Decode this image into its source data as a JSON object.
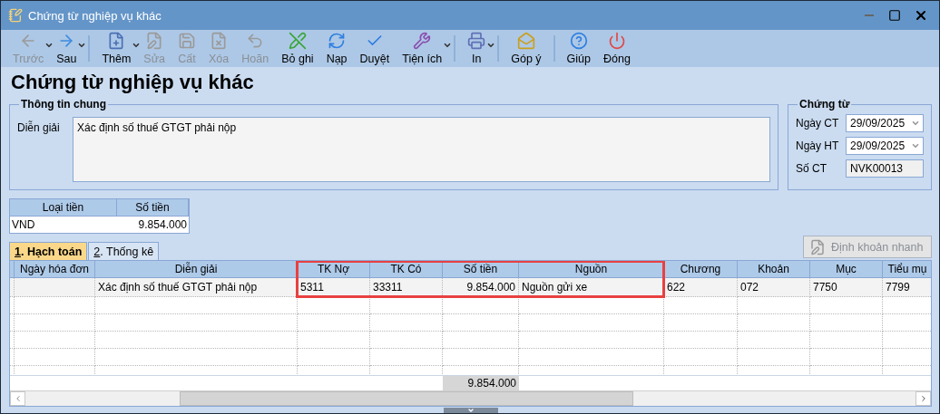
{
  "window": {
    "title": "Chứng từ nghiệp vụ khác"
  },
  "toolbar": [
    {
      "kind": "button",
      "label": "Trước",
      "disabled": true,
      "dropdown": true
    },
    {
      "kind": "button",
      "label": "Sau",
      "disabled": false,
      "dropdown": true
    },
    {
      "kind": "separator"
    },
    {
      "kind": "button",
      "label": "Thêm",
      "disabled": false,
      "dropdown": true
    },
    {
      "kind": "button",
      "label": "Sửa",
      "disabled": true,
      "dropdown": false
    },
    {
      "kind": "button",
      "label": "Cất",
      "disabled": true,
      "dropdown": false
    },
    {
      "kind": "button",
      "label": "Xóa",
      "disabled": true,
      "dropdown": false
    },
    {
      "kind": "button",
      "label": "Hoãn",
      "disabled": true,
      "dropdown": false
    },
    {
      "kind": "button",
      "label": "Bỏ ghi",
      "disabled": false,
      "dropdown": false
    },
    {
      "kind": "button",
      "label": "Nạp",
      "disabled": false,
      "dropdown": false
    },
    {
      "kind": "button",
      "label": "Duyệt",
      "disabled": false,
      "dropdown": false
    },
    {
      "kind": "button",
      "label": "Tiện ích",
      "disabled": false,
      "dropdown": true
    },
    {
      "kind": "separator"
    },
    {
      "kind": "button",
      "label": "In",
      "disabled": false,
      "dropdown": true
    },
    {
      "kind": "separator"
    },
    {
      "kind": "button",
      "label": "Góp ý",
      "disabled": false,
      "dropdown": false
    },
    {
      "kind": "separator"
    },
    {
      "kind": "button",
      "label": "Giúp",
      "disabled": false,
      "dropdown": false
    },
    {
      "kind": "button",
      "label": "Đóng",
      "disabled": false,
      "dropdown": false
    }
  ],
  "heading": "Chứng từ nghiệp vụ khác",
  "general": {
    "title": "Thông tin chung",
    "description_label": "Diễn giải",
    "description": "Xác định số thuế GTGT phải nộp"
  },
  "voucher": {
    "title": "Chứng từ",
    "fields": [
      {
        "kind": "date",
        "label": "Ngày CT",
        "value": "29/09/2025"
      },
      {
        "kind": "date",
        "label": "Ngày HT",
        "value": "29/09/2025"
      },
      {
        "kind": "readonly",
        "label": "Số CT",
        "value": "NVK00013"
      }
    ]
  },
  "currency_table": {
    "columns": [
      "Loại tiền",
      "Số tiền"
    ],
    "rows": [
      [
        "VND",
        "9.854.000"
      ]
    ]
  },
  "tabs": [
    {
      "label": "1. Hạch toán",
      "selected": true
    },
    {
      "label": "2. Thống kê",
      "selected": false
    }
  ],
  "quick_button": {
    "label": "Định khoản nhanh",
    "disabled": true
  },
  "table": {
    "columns": [
      {
        "label": "Ngày hóa đơn",
        "kind": "text",
        "highlighted": false
      },
      {
        "label": "Diễn giải",
        "kind": "text",
        "highlighted": false
      },
      {
        "label": "TK Nợ",
        "kind": "text",
        "highlighted": true
      },
      {
        "label": "TK Có",
        "kind": "text",
        "highlighted": true
      },
      {
        "label": "Số tiền",
        "kind": "amount",
        "highlighted": true,
        "total": "9.854.000"
      },
      {
        "label": "Nguồn",
        "kind": "text",
        "highlighted": true
      },
      {
        "label": "Chương",
        "kind": "text",
        "highlighted": false
      },
      {
        "label": "Khoản",
        "kind": "text",
        "highlighted": false
      },
      {
        "label": "Mục",
        "kind": "text",
        "highlighted": false
      },
      {
        "label": "Tiểu mụ",
        "kind": "text",
        "highlighted": false
      }
    ],
    "rows": [
      [
        "",
        "Xác định số thuế GTGT phải nộp",
        "5311",
        "33311",
        "9.854.000",
        "Nguồn gửi xe",
        "622",
        "072",
        "7750",
        "7799"
      ]
    ]
  }
}
